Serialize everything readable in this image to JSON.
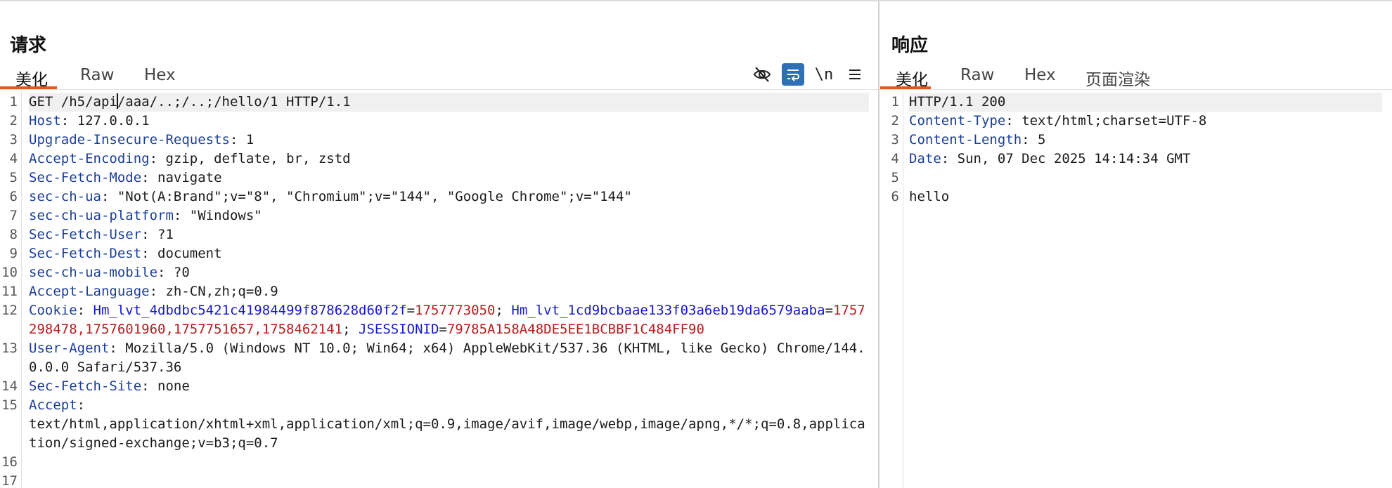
{
  "request": {
    "title": "请求",
    "tabs": [
      {
        "label": "美化",
        "active": true
      },
      {
        "label": "Raw",
        "active": false
      },
      {
        "label": "Hex",
        "active": false
      }
    ],
    "tools": [
      {
        "icon": "eye-off-icon"
      },
      {
        "icon": "wrap-lines-icon",
        "active": true
      },
      {
        "icon": "newline-icon",
        "label": "\\n"
      },
      {
        "icon": "menu-icon"
      }
    ],
    "lines": [
      {
        "n": "1",
        "request_line_a": "GET /h5/api",
        "request_line_b": "/aaa/..;/..;/hello/1 HTTP/1.1"
      },
      {
        "n": "2",
        "name": "Host",
        "sep": ": ",
        "value": "127.0.0.1"
      },
      {
        "n": "3",
        "name": "Upgrade-Insecure-Requests",
        "sep": ": ",
        "value": "1"
      },
      {
        "n": "4",
        "name": "Accept-Encoding",
        "sep": ": ",
        "value": "gzip, deflate, br, zstd"
      },
      {
        "n": "5",
        "name": "Sec-Fetch-Mode",
        "sep": ": ",
        "value": "navigate"
      },
      {
        "n": "6",
        "name": "sec-ch-ua",
        "sep": ": ",
        "value": "\"Not(A:Brand\";v=\"8\", \"Chromium\";v=\"144\", \"Google Chrome\";v=\"144\""
      },
      {
        "n": "7",
        "name": "sec-ch-ua-platform",
        "sep": ": ",
        "value": "\"Windows\""
      },
      {
        "n": "8",
        "name": "Sec-Fetch-User",
        "sep": ": ",
        "value": "?1"
      },
      {
        "n": "9",
        "name": "Sec-Fetch-Dest",
        "sep": ": ",
        "value": "document"
      },
      {
        "n": "10",
        "name": "sec-ch-ua-mobile",
        "sep": ": ",
        "value": "?0"
      },
      {
        "n": "11",
        "name": "Accept-Language",
        "sep": ": ",
        "value": "zh-CN,zh;q=0.9"
      },
      {
        "n": "12",
        "name": "Cookie",
        "sep": ": ",
        "cookies": [
          {
            "key": "Hm_lvt_4dbdbc5421c41984499f878628d60f2f",
            "eq": "=",
            "val": "1757773050",
            "sep": "; "
          },
          {
            "key": "Hm_lvt_1cd9bcbaae133f03a6eb19da6579aaba",
            "eq": "=",
            "val": "1757298478,1757601960,1757751657,1758462141",
            "sep": "; "
          },
          {
            "key": "JSESSIONID",
            "eq": "=",
            "val": "79785A158A48DE5EE1BCBBF1C484FF90",
            "sep": ""
          }
        ]
      },
      {
        "n": "13",
        "name": "User-Agent",
        "sep": ": ",
        "value": "Mozilla/5.0 (Windows NT 10.0; Win64; x64) AppleWebKit/537.36 (KHTML, like Gecko) Chrome/144.0.0.0 Safari/537.36"
      },
      {
        "n": "14",
        "name": "Sec-Fetch-Site",
        "sep": ": ",
        "value": "none"
      },
      {
        "n": "15",
        "name": "Accept",
        "sep": ":",
        "value": "text/html,application/xhtml+xml,application/xml;q=0.9,image/avif,image/webp,image/apng,*/*;q=0.8,application/signed-exchange;v=b3;q=0.7"
      },
      {
        "n": "16"
      },
      {
        "n": "17"
      }
    ]
  },
  "response": {
    "title": "响应",
    "tabs": [
      {
        "label": "美化",
        "active": true
      },
      {
        "label": "Raw",
        "active": false
      },
      {
        "label": "Hex",
        "active": false
      },
      {
        "label": "页面渲染",
        "active": false
      }
    ],
    "lines": [
      {
        "n": "1",
        "status": "HTTP/1.1 200"
      },
      {
        "n": "2",
        "name": "Content-Type",
        "sep": ": ",
        "value": "text/html;charset=UTF-8"
      },
      {
        "n": "3",
        "name": "Content-Length",
        "sep": ": ",
        "value": "5"
      },
      {
        "n": "4",
        "name": "Date",
        "sep": ": ",
        "value": "Sun, 07 Dec 2025 14:14:34 GMT"
      },
      {
        "n": "5"
      },
      {
        "n": "6",
        "body": "hello"
      }
    ]
  }
}
